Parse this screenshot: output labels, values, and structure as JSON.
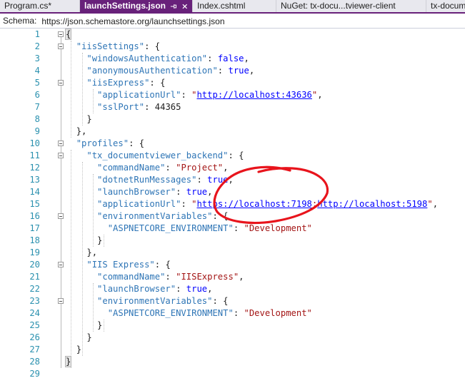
{
  "tabs": [
    {
      "label": "Program.cs*",
      "active": false
    },
    {
      "label": "launchSettings.json",
      "active": true
    },
    {
      "label": "Index.cshtml",
      "active": false
    },
    {
      "label": "NuGet: tx-docu...tviewer-client",
      "active": false
    },
    {
      "label": "tx-docum",
      "active": false
    }
  ],
  "schema": {
    "label": "Schema:",
    "value": "https://json.schemastore.org/launchsettings.json"
  },
  "colors": {
    "accent_tab": "#68217a",
    "line_number": "#2b91af",
    "property_key": "#2e75b6",
    "string_value": "#a31515",
    "keyword": "#0000ff",
    "annotation_red": "#e8141c"
  },
  "code_lines": [
    {
      "n": "1",
      "t": "{"
    },
    {
      "n": "2",
      "t": "  \"iisSettings\": {"
    },
    {
      "n": "3",
      "t": "    \"windowsAuthentication\": false,"
    },
    {
      "n": "4",
      "t": "    \"anonymousAuthentication\": true,"
    },
    {
      "n": "5",
      "t": "    \"iisExpress\": {"
    },
    {
      "n": "6",
      "t": "      \"applicationUrl\": \"http://localhost:43636\","
    },
    {
      "n": "7",
      "t": "      \"sslPort\": 44365"
    },
    {
      "n": "8",
      "t": "    }"
    },
    {
      "n": "9",
      "t": "  },"
    },
    {
      "n": "10",
      "t": "  \"profiles\": {"
    },
    {
      "n": "11",
      "t": "    \"tx_documentviewer_backend\": {"
    },
    {
      "n": "12",
      "t": "      \"commandName\": \"Project\","
    },
    {
      "n": "13",
      "t": "      \"dotnetRunMessages\": true,"
    },
    {
      "n": "14",
      "t": "      \"launchBrowser\": true,"
    },
    {
      "n": "15",
      "t": "      \"applicationUrl\": \"https://localhost:7198;http://localhost:5198\","
    },
    {
      "n": "16",
      "t": "      \"environmentVariables\": {"
    },
    {
      "n": "17",
      "t": "        \"ASPNETCORE_ENVIRONMENT\": \"Development\""
    },
    {
      "n": "18",
      "t": "      }"
    },
    {
      "n": "19",
      "t": "    },"
    },
    {
      "n": "20",
      "t": "    \"IIS Express\": {"
    },
    {
      "n": "21",
      "t": "      \"commandName\": \"IISExpress\","
    },
    {
      "n": "22",
      "t": "      \"launchBrowser\": true,"
    },
    {
      "n": "23",
      "t": "      \"environmentVariables\": {"
    },
    {
      "n": "24",
      "t": "        \"ASPNETCORE_ENVIRONMENT\": \"Development\""
    },
    {
      "n": "25",
      "t": "      }"
    },
    {
      "n": "26",
      "t": "    }"
    },
    {
      "n": "27",
      "t": "  }"
    },
    {
      "n": "28",
      "t": "}"
    },
    {
      "n": "29",
      "t": ""
    }
  ]
}
